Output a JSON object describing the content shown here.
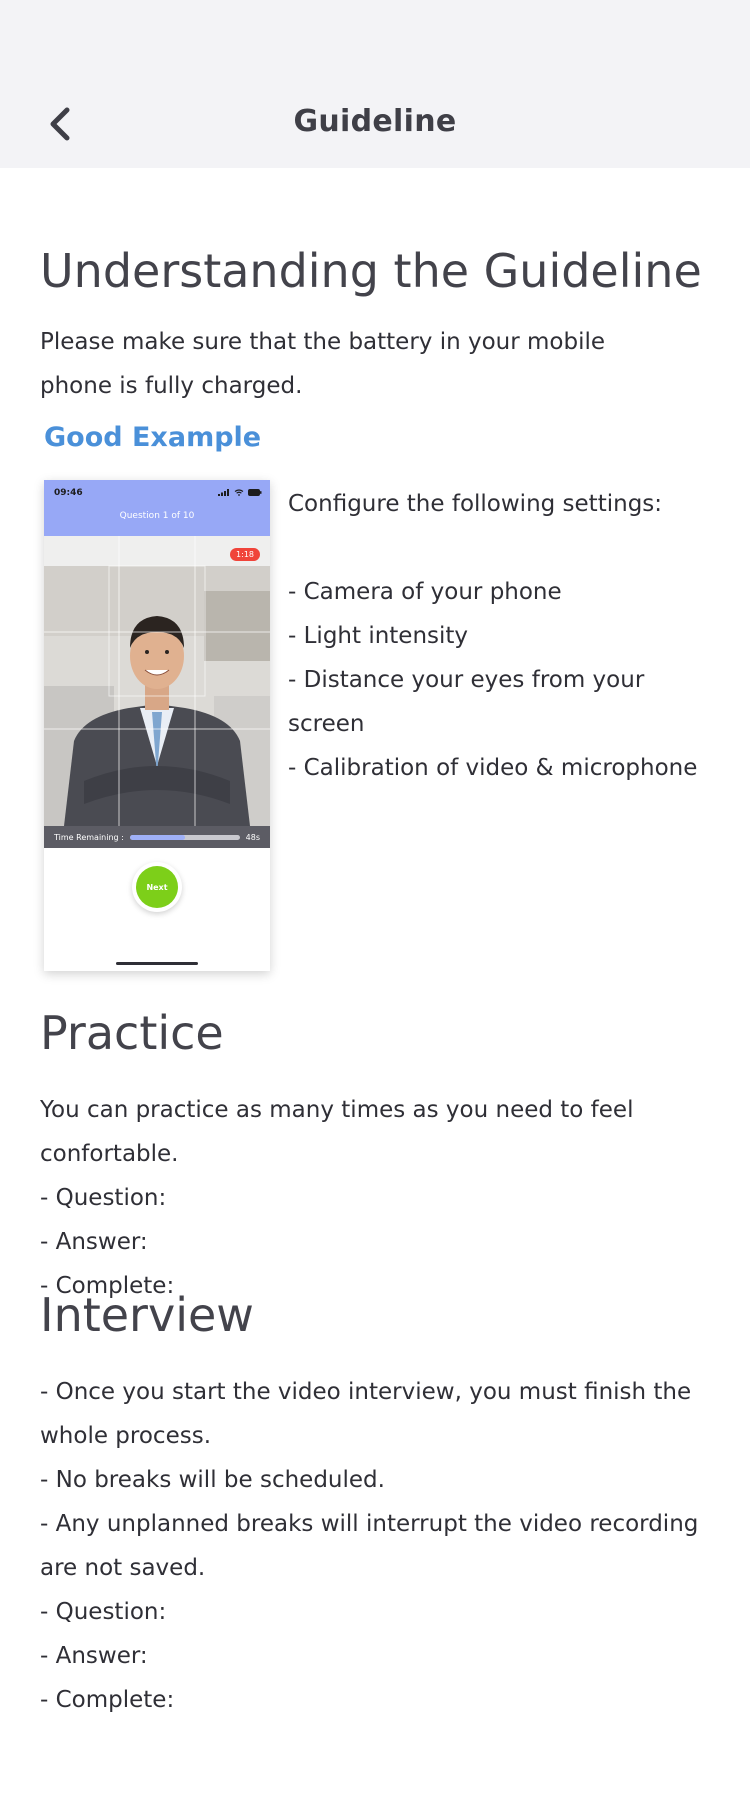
{
  "header": {
    "title": "Guideline"
  },
  "section_understanding": {
    "title": "Understanding the Guideline",
    "body": "Please make sure that the battery in your mobile phone is fully charged."
  },
  "good_example": {
    "label": "Good Example",
    "phone": {
      "time": "09:46",
      "question": "Question 1 of 10",
      "timer": "1:18",
      "time_remaining_label": "Time Remaining :",
      "seconds": "48s",
      "progress": 0.5,
      "next_label": "Next"
    },
    "config_intro": "Configure the following settings:",
    "config_items": [
      "- Camera of your phone",
      "- Light intensity",
      "- Distance your eyes from your screen",
      "- Calibration of video & microphone"
    ]
  },
  "section_practice": {
    "title": "Practice",
    "lines": [
      "You can practice as many times as you need to feel confortable.",
      "- Question:",
      "- Answer:",
      "- Complete:"
    ]
  },
  "section_interview": {
    "title": "Interview",
    "lines": [
      "- Once you start the video interview, you must finish the whole process.",
      "- No breaks will be scheduled.",
      "- Any unplanned breaks will interrupt the video recording are not saved.",
      "- Question:",
      "- Answer:",
      "- Complete:"
    ]
  },
  "colors": {
    "header_bg": "#f3f3f6",
    "accent_blue": "#4a90d9",
    "phone_header": "#97a8f6",
    "next_green": "#7dcf19",
    "timer_red": "#f0443a"
  }
}
